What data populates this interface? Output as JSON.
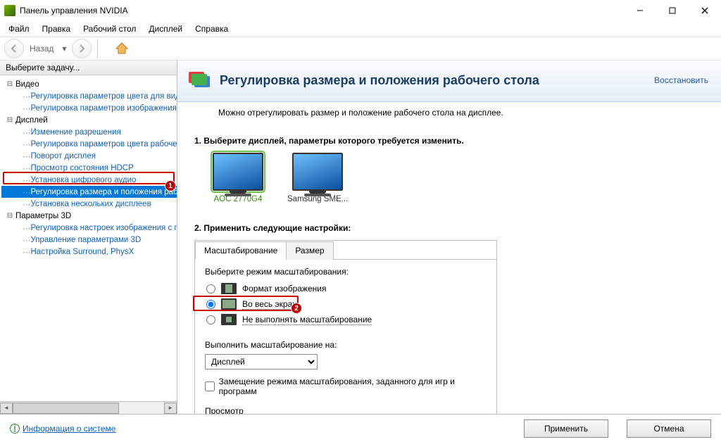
{
  "window": {
    "title": "Панель управления NVIDIA"
  },
  "menubar": [
    "Файл",
    "Правка",
    "Рабочий стол",
    "Дисплей",
    "Справка"
  ],
  "toolbar": {
    "back_label": "Назад"
  },
  "sidebar": {
    "header": "Выберите задачу...",
    "groups": [
      {
        "name": "Видео",
        "items": [
          "Регулировка параметров цвета для вид",
          "Регулировка параметров изображения д"
        ]
      },
      {
        "name": "Дисплей",
        "items": [
          "Изменение разрешения",
          "Регулировка параметров цвета рабочег",
          "Поворот дисплея",
          "Просмотр состояния HDCP",
          "Установка цифрового аудио",
          "Регулировка размера и положения рабоч",
          "Установка нескольких дисплеев"
        ],
        "selected_index": 5
      },
      {
        "name": "Параметры 3D",
        "items": [
          "Регулировка настроек изображения с пр",
          "Управление параметрами 3D",
          "Настройка Surround, PhysX"
        ]
      }
    ]
  },
  "page": {
    "title": "Регулировка размера и положения рабочего стола",
    "restore": "Восстановить",
    "subtitle": "Можно отрегулировать размер и положение рабочего стола на дисплее.",
    "step1": "1. Выберите дисплей, параметры которого требуется изменить.",
    "displays": [
      {
        "label": "AOC 2770G4",
        "selected": true
      },
      {
        "label": "Samsung SME...",
        "selected": false
      }
    ],
    "step2": "2. Применить следующие настройки:",
    "tabs": {
      "scaling": "Масштабирование",
      "size": "Размер"
    },
    "scaling": {
      "mode_label": "Выберите режим масштабирования:",
      "options": {
        "aspect": "Формат изображения",
        "full": "Во весь экран",
        "none": "Не выполнять масштабирование"
      },
      "selected": "full",
      "perform_on_label": "Выполнить масштабирование на:",
      "perform_on_value": "Дисплей",
      "override_label": "Замещение режима масштабирования, заданного для игр и программ",
      "preview_label": "Просмотр"
    }
  },
  "badges": {
    "one": "1",
    "two": "2"
  },
  "footer": {
    "sys_info": "Информация о системе",
    "apply": "Применить",
    "cancel": "Отмена"
  }
}
